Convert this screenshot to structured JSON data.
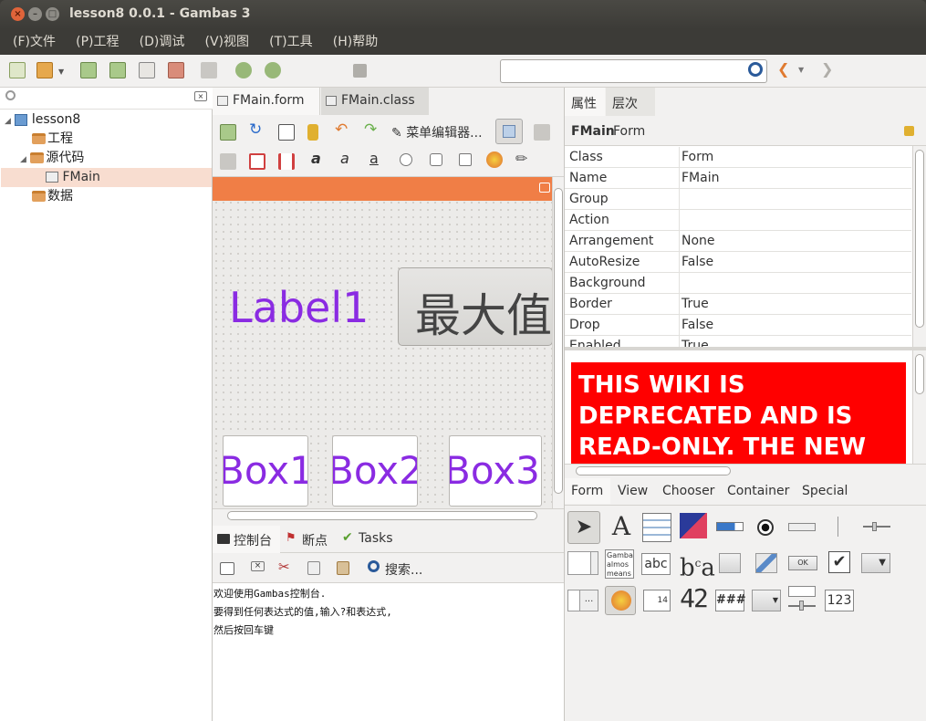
{
  "window": {
    "title": "lesson8 0.0.1 - Gambas 3"
  },
  "menu": [
    "(F)文件",
    "(P)工程",
    "(D)调试",
    "(V)视图",
    "(T)工具",
    "(H)帮助"
  ],
  "project_tree": {
    "root": "lesson8",
    "items": [
      "工程",
      "源代码",
      "FMain",
      "数据"
    ]
  },
  "editor_tabs": [
    "FMain.form",
    "FMain.class"
  ],
  "form_toolbar": {
    "menu_editor_label": "菜单编辑器..."
  },
  "form": {
    "label_text": "Label1",
    "button_text": "最大值",
    "boxes": [
      "Box1",
      "Box2",
      "Box3"
    ]
  },
  "bottom_tabs": [
    "控制台",
    "断点",
    "Tasks"
  ],
  "console": {
    "search_label": "搜索...",
    "lines": [
      "欢迎使用Gambas控制台.",
      "要得到任何表达式的值,输入?和表达式,",
      "然后按回车键"
    ]
  },
  "properties": {
    "tabs": [
      "属性",
      "层次"
    ],
    "header_object": "FMain",
    "header_type": "Form",
    "rows": [
      {
        "name": "Class",
        "value": "Form"
      },
      {
        "name": "Name",
        "value": "FMain"
      },
      {
        "name": "Group",
        "value": ""
      },
      {
        "name": "Action",
        "value": ""
      },
      {
        "name": "Arrangement",
        "value": "None"
      },
      {
        "name": "AutoResize",
        "value": "False"
      },
      {
        "name": "Background",
        "value": ""
      },
      {
        "name": "Border",
        "value": "True"
      },
      {
        "name": "Drop",
        "value": "False"
      },
      {
        "name": "Enabled",
        "value": "True"
      }
    ],
    "help_text": "THIS WIKI IS DEPRECATED AND IS READ-ONLY. THE NEW"
  },
  "toolbox": {
    "tabs": [
      "Form",
      "View",
      "Chooser",
      "Container",
      "Special"
    ],
    "label_icon_text": "A",
    "textbox_text": "abc",
    "textlabel_text": "Gamba almos means",
    "ok_text": "OK",
    "lcd_text": "42",
    "mask_text": "###",
    "spin_text": "123",
    "date_text": "14"
  },
  "colors": {
    "accent": "#f07e46",
    "purple_text": "#8a2be2",
    "wiki_red": "#ff0000"
  }
}
